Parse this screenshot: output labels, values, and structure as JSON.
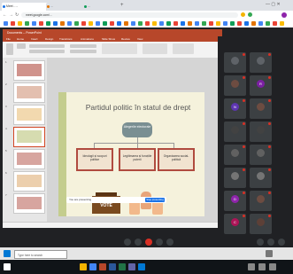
{
  "browser": {
    "tabs": [
      {
        "label": "Meet - ..."
      },
      {
        "label": "..."
      },
      {
        "label": "..."
      }
    ],
    "url": "meet.google.com/..."
  },
  "powerpoint": {
    "window_title": "Documents -- PowerPoint",
    "ribbon_tabs": [
      "File",
      "Home",
      "Insert",
      "Design",
      "Transitions",
      "Animations",
      "Slide Show",
      "Review",
      "View"
    ],
    "slide_numbers": [
      "1",
      "2",
      "3",
      "4",
      "5",
      "6",
      "7"
    ]
  },
  "slide": {
    "title": "Partidul politic în statul de drept",
    "top_node": "Alegerile electorale",
    "nodes": [
      "Ideologii și scopuri politice",
      "Legitimarea și funcțiile puterii",
      "Organizarea social-politică"
    ],
    "ballot_label": "VOTE"
  },
  "presenting": {
    "text": "You are presenting",
    "stop_label": "Stop presenting"
  },
  "taskbar": {
    "search_placeholder": "Type here to search"
  },
  "participants": [
    {
      "initial": "",
      "color": "#5f6368"
    },
    {
      "initial": "",
      "color": "#5f6368"
    },
    {
      "initial": "",
      "color": "#6d4c41"
    },
    {
      "initial": "R",
      "color": "#7b1fa2"
    },
    {
      "initial": "N",
      "color": "#5e35b1"
    },
    {
      "initial": "",
      "color": "#6d4c41"
    },
    {
      "initial": "",
      "color": "#424242"
    },
    {
      "initial": "",
      "color": "#424242"
    },
    {
      "initial": "",
      "color": "#616161"
    },
    {
      "initial": "",
      "color": "#616161"
    },
    {
      "initial": "",
      "color": "#757575"
    },
    {
      "initial": "",
      "color": "#757575"
    },
    {
      "initial": "D",
      "color": "#8e24aa"
    },
    {
      "initial": "",
      "color": "#6d4c41"
    },
    {
      "initial": "C",
      "color": "#ad1457"
    },
    {
      "initial": "",
      "color": "#5d4037"
    }
  ]
}
